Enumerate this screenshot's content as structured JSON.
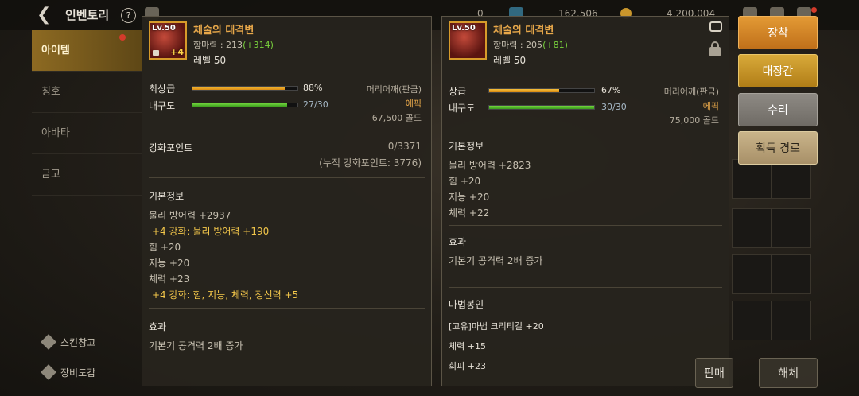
{
  "header": {
    "title": "인벤토리",
    "help": "?",
    "currency1": "0",
    "currency2": "162,506",
    "currency3": "4,200,004"
  },
  "sidebar": {
    "items": [
      {
        "label": "아이템"
      },
      {
        "label": "칭호"
      },
      {
        "label": "아바타"
      },
      {
        "label": "금고"
      }
    ],
    "footer": [
      {
        "label": "스킨창고"
      },
      {
        "label": "장비도감"
      }
    ]
  },
  "left_item": {
    "level_badge": "Lv.50",
    "enhance": "+4",
    "name": "체술의 대격변",
    "resist_label": "항마력 : 213",
    "resist_plus": "(+314)",
    "level": "레벨 50",
    "grade_label": "최상급",
    "grade_pct_text": "88%",
    "grade_pct": 88,
    "durability_label": "내구도",
    "durability": "27/30",
    "durability_ratio": 0.9,
    "slot": "머리어깨(판금)",
    "rarity": "에픽",
    "price": "67,500 골드",
    "reinforce_label": "강화포인트",
    "reinforce_value": "0/3371",
    "reinforce_total": "(누적 강화포인트: 3776)",
    "basic_title": "기본정보",
    "basic": [
      {
        "text": "물리 방어력 +2937",
        "hl": false
      },
      {
        "text": "+4 강화: 물리 방어력 +190",
        "hl": true
      },
      {
        "text": "힘 +20",
        "hl": false
      },
      {
        "text": "지능 +20",
        "hl": false
      },
      {
        "text": "체력 +23",
        "hl": false
      },
      {
        "text": "+4 강화: 힘, 지능, 체력, 정신력 +5",
        "hl": true
      }
    ],
    "effect_title": "효과",
    "effect": "기본기 공격력 2배 증가"
  },
  "right_item": {
    "level_badge": "Lv.50",
    "name": "체술의 대격변",
    "resist_label": "항마력 : 205",
    "resist_plus": "(+81)",
    "level": "레벨 50",
    "grade_label": "상급",
    "grade_pct_text": "67%",
    "grade_pct": 67,
    "durability_label": "내구도",
    "durability": "30/30",
    "durability_ratio": 1.0,
    "slot": "머리어깨(판금)",
    "rarity": "에픽",
    "price": "75,000 골드",
    "basic_title": "기본정보",
    "basic": [
      {
        "text": "물리 방어력 +2823"
      },
      {
        "text": "힘 +20"
      },
      {
        "text": "지능 +20"
      },
      {
        "text": "체력 +22"
      }
    ],
    "effect_title": "효과",
    "effect": "기본기 공격력 2배 증가",
    "seal_title": "마법봉인",
    "seal": [
      {
        "text": "[고유]마법 크리티컬 +20"
      },
      {
        "text": "체력 +15"
      },
      {
        "text": "회피 +23"
      }
    ]
  },
  "actions": {
    "equip": "장착",
    "forge": "대장간",
    "repair": "수리",
    "acquire": "획득 경로",
    "sell": "판매",
    "disassemble": "해체"
  },
  "colors": {
    "accent": "#e8a84a",
    "plus": "#79d23d",
    "highlight": "#f2c64a"
  }
}
